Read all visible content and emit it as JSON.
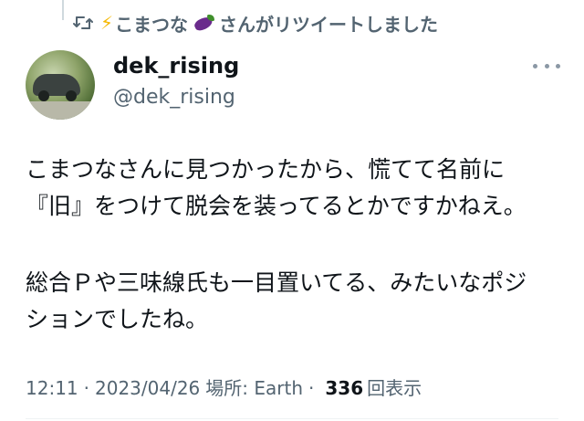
{
  "retweet": {
    "prefix": "こまつな",
    "suffix": "さんがリツイートしました",
    "bolt_emoji": "⚡",
    "icon": "retweet-icon",
    "emoji_icon": "eggplant-icon"
  },
  "author": {
    "display_name": "dek_rising",
    "handle": "@dek_rising",
    "avatar_icon": "avatar-car-photo"
  },
  "tweet": {
    "lines": [
      "こまつなさんに見つかったから、慌てて名前に",
      "『旧』をつけて脱会を装ってるとかですかねえ。",
      "",
      "総合Ｐや三味線氏も一目置いてる、みたいなポジ",
      "ションでしたね。"
    ]
  },
  "meta": {
    "time": "12:11",
    "date": "2023/04/26",
    "location": "場所: Earth",
    "views_count": "336",
    "views_label": "回表示",
    "separator": "·"
  },
  "colors": {
    "text_primary": "#0f1419",
    "text_secondary": "#536471",
    "divider": "#eff3f4"
  }
}
